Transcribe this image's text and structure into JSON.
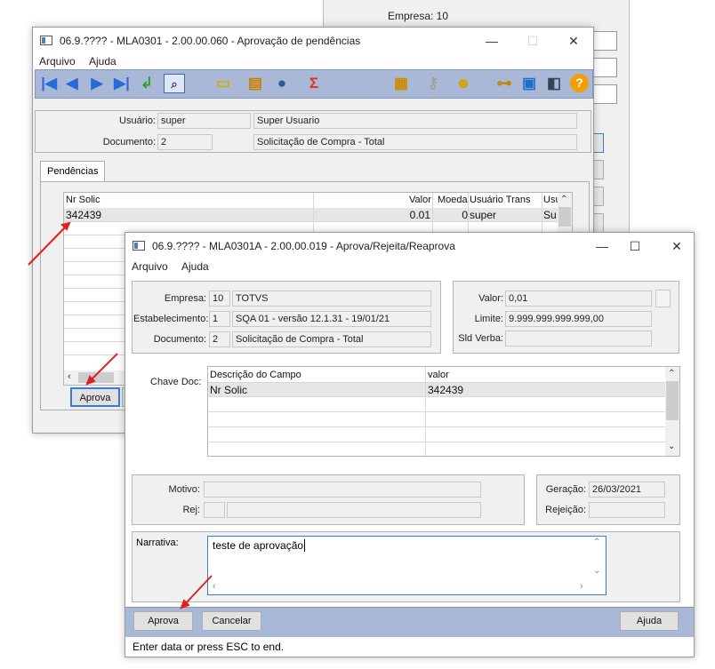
{
  "background_window": {
    "empresa_label": "Empresa: 10"
  },
  "win1": {
    "title": "06.9.???? - MLA0301 - 2.00.00.060 - Aprovação de pendências",
    "menu": [
      "Arquivo",
      "Ajuda"
    ],
    "usuario_label": "Usuário:",
    "usuario_value": "super",
    "usuario_name": "Super Usuario",
    "documento_label": "Documento:",
    "documento_value": "2",
    "documento_desc": "Solicitação de Compra - Total",
    "tab_label": "Pendências",
    "grid_headers": [
      "Nr Solic",
      "Valor",
      "Moeda",
      "Usuário Trans",
      "Usu"
    ],
    "grid_row": [
      "342439",
      "0.01",
      "0",
      "super",
      "Su"
    ],
    "aprova_button": "Aprova"
  },
  "win2": {
    "title": "06.9.???? - MLA0301A - 2.00.00.019 - Aprova/Rejeita/Reaprova",
    "menu": [
      "Arquivo",
      "Ajuda"
    ],
    "empresa_label": "Empresa:",
    "empresa_code": "10",
    "empresa_name": "TOTVS",
    "estab_label": "Estabelecimento:",
    "estab_code": "1",
    "estab_name": "SQA 01 - versão 12.1.31 - 19/01/21",
    "documento_label": "Documento:",
    "documento_code": "2",
    "documento_name": "Solicitação de Compra - Total",
    "valor_label": "Valor:",
    "valor_value": "0,01",
    "limite_label": "Limite:",
    "limite_value": "9.999.999.999.999,00",
    "sld_verba_label": "Sld Verba:",
    "sld_verba_value": "",
    "chave_doc_label": "Chave Doc:",
    "chave_headers": [
      "Descrição do Campo",
      "valor"
    ],
    "chave_row": [
      "Nr Solic",
      "342439"
    ],
    "motivo_label": "Motivo:",
    "rej_label": "Rej:",
    "geracao_label": "Geração:",
    "geracao_value": "26/03/2021",
    "rejeicao_label": "Rejeição:",
    "narrativa_label": "Narrativa:",
    "narrativa_value": "teste de aprovação",
    "aprova_button": "Aprova",
    "cancelar_button": "Cancelar",
    "ajuda_button": "Ajuda",
    "status_text": "Enter data or press ESC to end."
  },
  "colors": {
    "toolbar": "#aab8d8",
    "arrow": "#e02020",
    "selected_row": "#e6e6e6"
  }
}
